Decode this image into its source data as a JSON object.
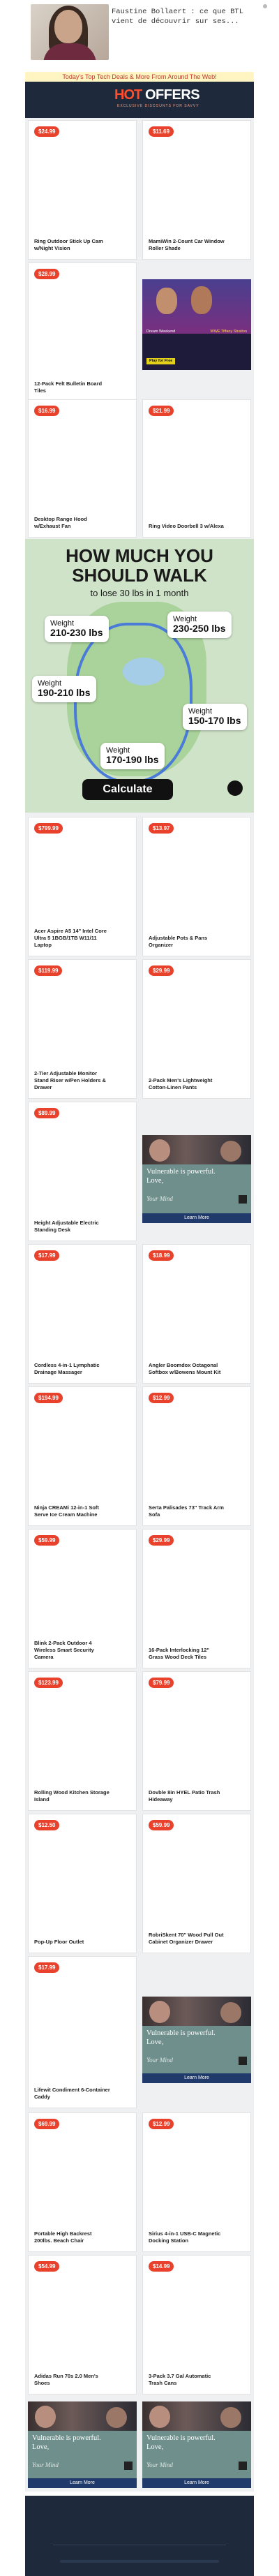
{
  "header": {
    "text": "Faustine Bollaert : ce que BTL vient de découvrir sur ses..."
  },
  "banner": {
    "text": "Today's Top Tech Deals & More From Around The Web!"
  },
  "logo": {
    "hot": "HOT",
    "offers": "OFFERS",
    "tagline": "EXCLUSIVE DISCOUNTS FOR SAVVY"
  },
  "products": [
    {
      "price": "$24.99",
      "title": "Ring Outdoor Stick Up Cam w/Night Vision"
    },
    {
      "price": "$11.69",
      "title": "MamiWin 2-Count Car Window Roller Shade"
    },
    {
      "price": "$28.99",
      "title": "12-Pack Felt Bulletin Board Tiles"
    },
    {
      "price": "$16.99",
      "title": "Desktop Range Hood w/Exhaust Fan"
    },
    {
      "price": "$21.99",
      "title": "Ring Video Doorbell 3 w/Alexa"
    },
    {
      "price": "$799.99",
      "title": "Acer Aspire A5 14\" Intel Core Ultra 5 1BGB/1TB W11/11 Laptop"
    },
    {
      "price": "$13.97",
      "title": "Adjustable Pots & Pans Organizer"
    },
    {
      "price": "$119.99",
      "title": "2-Tier Adjustable Monitor Stand Riser w/Pen Holders & Drawer"
    },
    {
      "price": "$29.99",
      "title": "2-Pack Men's Lightweight Cotton-Linen Pants"
    },
    {
      "price": "$89.99",
      "title": "Height Adjustable Electric Standing Desk"
    },
    {
      "price": "$17.99",
      "title": "Cordless 4-in-1 Lymphatic Drainage Massager"
    },
    {
      "price": "$18.99",
      "title": "Angler Boomdox Octagonal Softbox w/Bowens Mount Kit"
    },
    {
      "price": "$194.99",
      "title": "Ninja CREAMi 12-in-1 Soft Serve Ice Cream Machine"
    },
    {
      "price": "$12.99",
      "title": "Serta Palisades 73\" Track Arm Sofa"
    },
    {
      "price": "$59.99",
      "title": "Blink 2-Pack Outdoor 4 Wireless Smart Security Camera"
    },
    {
      "price": "$29.99",
      "title": "16-Pack Interlocking 12\" Grass Wood Deck Tiles"
    },
    {
      "price": "$123.99",
      "title": "Rolling Wood Kitchen Storage Island"
    },
    {
      "price": "$79.99",
      "title": "Dovble 8in HYEL Patio Trash Hideaway"
    },
    {
      "price": "$12.50",
      "title": "Pop-Up Floor Outlet"
    },
    {
      "price": "$59.99",
      "title": "RobriSkent 70\" Wood Pull Out Cabinet Organizer Drawer"
    },
    {
      "price": "$17.99",
      "title": "Lifewit Condiment 6-Container Caddy"
    },
    {
      "price": "$69.99",
      "title": "Portable High Backrest 200lbs. Beach Chair"
    },
    {
      "price": "$12.99",
      "title": "Sirius 4-in-1 USB-C Magnetic Docking Station"
    },
    {
      "price": "$54.99",
      "title": "Adidas Run 70s 2.0 Men's Shoes"
    },
    {
      "price": "$14.99",
      "title": "3-Pack 3.7 Gal Automatic Trash Cans"
    }
  ],
  "ad_vulnerable": {
    "headline": "Vulnerable is powerful.",
    "line2": "Love,",
    "signature": "Your Mind",
    "button": "Learn More"
  },
  "ad_wwe": {
    "left": "Dream Weekend",
    "right": "WWE Tiffany Stratton",
    "cta": "Play for Free"
  },
  "weight_ad": {
    "headline": "HOW MUCH YOU SHOULD WALK",
    "sub": "to lose 30 lbs in 1 month",
    "boxes": [
      {
        "label": "Weight",
        "value": "210-230 lbs"
      },
      {
        "label": "Weight",
        "value": "230-250 lbs"
      },
      {
        "label": "Weight",
        "value": "190-210 lbs"
      },
      {
        "label": "Weight",
        "value": "150-170 lbs"
      },
      {
        "label": "Weight",
        "value": "170-190 lbs"
      }
    ],
    "button": "Calculate"
  }
}
